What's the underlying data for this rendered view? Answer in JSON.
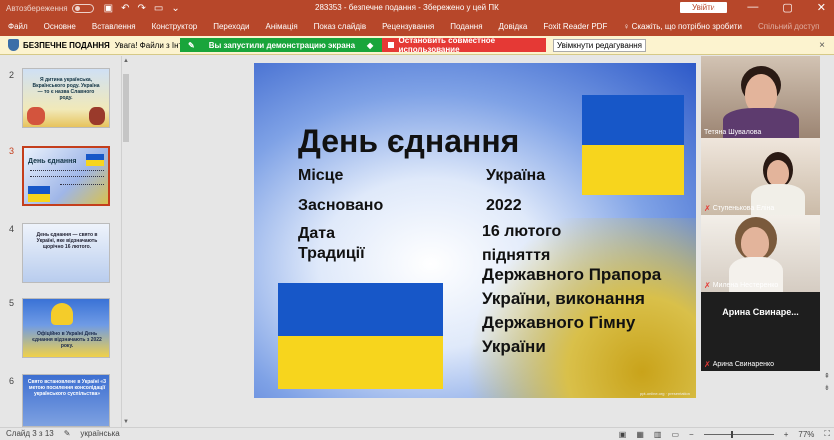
{
  "titlebar": {
    "autosave_label": "Автозбереження",
    "doc_title": "283353 - безпечне подання - Збережено у цей ПК",
    "signin": "Увійти",
    "minimize": "—",
    "maximize": "▢",
    "close": "✕"
  },
  "ribbon_tabs": [
    "Файл",
    "Основне",
    "Вставлення",
    "Конструктор",
    "Переходи",
    "Анімація",
    "Показ слайдів",
    "Рецензування",
    "Подання",
    "Довідка",
    "Foxit Reader PDF",
    "♀ Скажіть, що потрібно зробити"
  ],
  "share_label": "Спільний доступ",
  "protected_bar": {
    "title": "БЕЗПЕЧНЕ ПОДАННЯ",
    "message": "Увага! Файли з Інтерне",
    "demo_notice": "Вы запустили демонстрацию экрана",
    "stop_button": "Остановить совместное использование",
    "enable_button": "Увімкнути редагування",
    "close": "×"
  },
  "thumbnails": [
    {
      "num": "2",
      "text": "Я дитина українська, Вкраїнського роду. Україна — то є назва Славного роду."
    },
    {
      "num": "3",
      "text": "День єднання"
    },
    {
      "num": "4",
      "text": "День єднання — свято в Україні, яке відзначають щорічно 16 лютого."
    },
    {
      "num": "5",
      "text": "Офіційно в Україні День єднання відзначають з 2022 року."
    },
    {
      "num": "6",
      "text": "Свято встановлене в Україні «З метою посилення консолідації українського суспільства»"
    }
  ],
  "slide": {
    "title": "День єднання",
    "labels": [
      "Місце",
      "Засновано",
      "Дата",
      "Традиції"
    ],
    "values": [
      "Україна",
      "2022",
      "16 лютого",
      "підняття"
    ],
    "tradition_lines": [
      "Державного Прапора",
      "України, виконання",
      "Державного Гімну",
      "України"
    ],
    "footer": "ppt-online.org · presentation"
  },
  "participants": [
    {
      "name": "Тетяна Шувалова",
      "muted": false
    },
    {
      "name": "Ступенькова Еліна",
      "muted": true
    },
    {
      "name": "Милена Нестеренко",
      "muted": true
    },
    {
      "name": "Арина Свинаренко",
      "muted": true,
      "placeholder": "Арина Свинаре..."
    }
  ],
  "status": {
    "slide_info": "Слайд 3 з 13",
    "language": "українська",
    "zoom": "77%",
    "zoom_fraction": 0.77
  },
  "colors": {
    "ribbon": "#b7472a",
    "accent": "#c43e1c",
    "flag_blue": "#1757c8",
    "flag_yellow": "#f7d51d"
  }
}
